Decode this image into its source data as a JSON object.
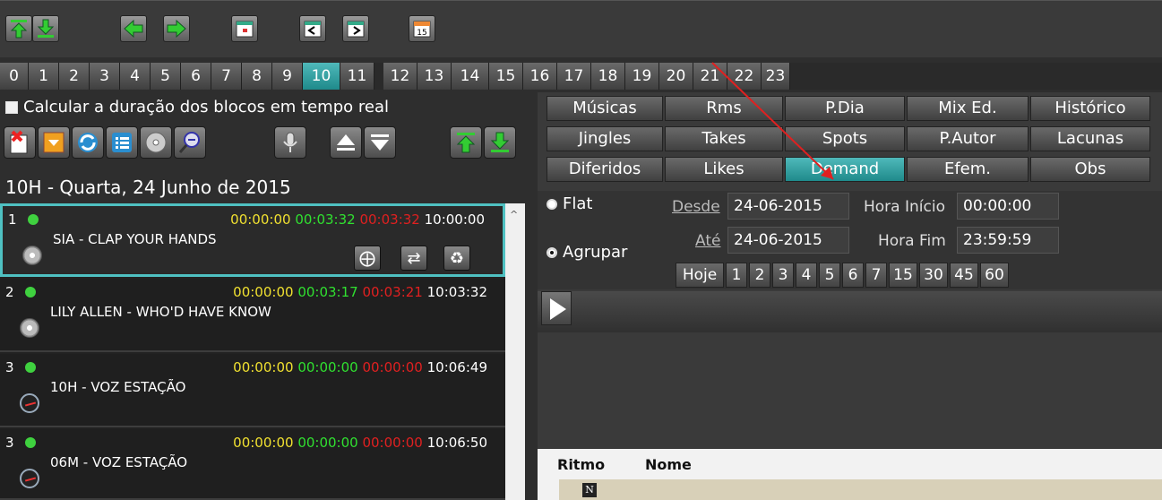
{
  "toolbar": {
    "buttons": [
      "move-top-icon",
      "move-bottom-icon",
      "arrow-left-icon",
      "arrow-right-icon",
      "calendar-icon",
      "prev-day-icon",
      "next-day-icon",
      "calendar-15-icon"
    ],
    "calendar_day": "15"
  },
  "hours": [
    "0",
    "1",
    "2",
    "3",
    "4",
    "5",
    "6",
    "7",
    "8",
    "9",
    "10",
    "11",
    "12",
    "13",
    "14",
    "15",
    "16",
    "17",
    "18",
    "19",
    "20",
    "21",
    "22",
    "23"
  ],
  "selected_hour": "10",
  "left": {
    "checkbox_label": "Calcular a duração dos blocos em tempo real",
    "day_title": "10H - Quarta, 24 Junho de 2015",
    "items": [
      {
        "num": "1",
        "t1": "00:00:00",
        "t2": "00:03:32",
        "t3": "00:03:32",
        "t4": "10:00:00",
        "title": "SIA - CLAP YOUR HANDS",
        "icon": "cd-icon"
      },
      {
        "num": "2",
        "t1": "00:00:00",
        "t2": "00:03:17",
        "t3": "00:03:21",
        "t4": "10:03:32",
        "title": "LILY ALLEN - WHO'D HAVE KNOW",
        "icon": "cd-icon"
      },
      {
        "num": "3",
        "t1": "00:00:00",
        "t2": "00:00:00",
        "t3": "00:00:00",
        "t4": "10:06:49",
        "title": "10H - VOZ ESTAÇÃO",
        "icon": "gauge-icon"
      },
      {
        "num": "3",
        "t1": "00:00:00",
        "t2": "00:00:00",
        "t3": "00:00:00",
        "t4": "10:06:50",
        "title": "06M - VOZ ESTAÇÃO",
        "icon": "gauge-icon"
      }
    ]
  },
  "right": {
    "tabs_row1": [
      "Músicas",
      "Rms",
      "P.Dia",
      "Mix Ed.",
      "Histórico"
    ],
    "tabs_row2": [
      "Jingles",
      "Takes",
      "Spots",
      "P.Autor",
      "Lacunas"
    ],
    "tabs_row3": [
      "Diferidos",
      "Likes",
      "Demand",
      "Efem.",
      "Obs"
    ],
    "selected_tab": "Demand",
    "radio_flat": "Flat",
    "radio_group": "Agrupar",
    "desde_label": "Desde",
    "desde_value": "24-06-2015",
    "ate_label": "Até",
    "ate_value": "24-06-2015",
    "hora_inicio_label": "Hora Início",
    "hora_inicio_value": "00:00:00",
    "hora_fim_label": "Hora Fim",
    "hora_fim_value": "23:59:59",
    "quick": [
      "Hoje",
      "1",
      "2",
      "3",
      "4",
      "5",
      "6",
      "7",
      "15",
      "30",
      "45",
      "60"
    ],
    "grid_headers": [
      "Ritmo",
      "Nome"
    ],
    "grid_row_badge": "N"
  },
  "colors": {
    "accent": "#2aa3a4",
    "time_yellow": "#f0e030",
    "time_green": "#30e030",
    "time_red": "#e02020"
  }
}
